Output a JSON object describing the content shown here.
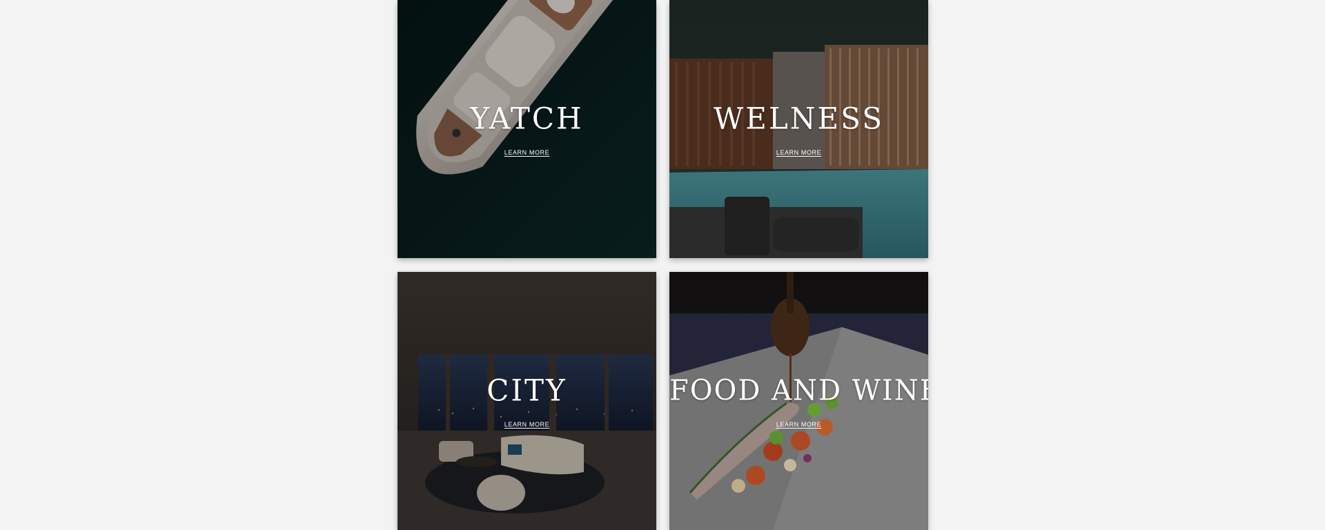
{
  "cards": [
    {
      "title": "YATCH",
      "link": "LEARN MORE",
      "image": "yacht-aerial-photo"
    },
    {
      "title": "WELNESS",
      "link": "LEARN MORE",
      "image": "indoor-pool-photo"
    },
    {
      "title": "CITY",
      "link": "LEARN MORE",
      "image": "city-apartment-photo"
    },
    {
      "title": "FOOD AND WINE",
      "link": "LEARN MORE",
      "image": "plated-dish-photo"
    }
  ],
  "colors": {
    "page_background": "#f3f3f3",
    "card_text": "#ffffff"
  }
}
